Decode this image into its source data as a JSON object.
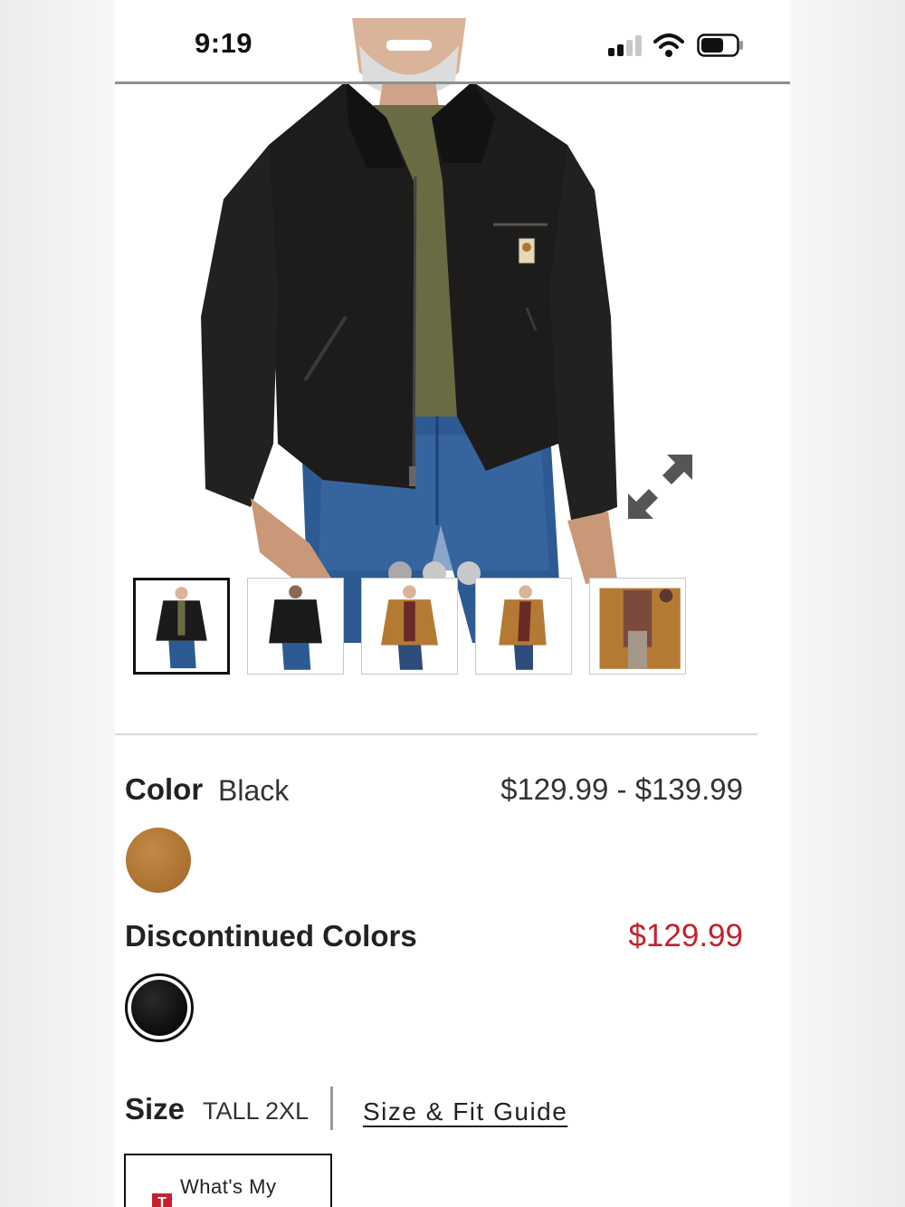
{
  "status_bar": {
    "time": "9:19"
  },
  "product": {
    "image_dots": 3,
    "thumbnails": [
      {
        "color": "black",
        "view": "front",
        "selected": true
      },
      {
        "color": "black",
        "view": "back",
        "selected": false
      },
      {
        "color": "brown",
        "view": "front",
        "selected": false
      },
      {
        "color": "brown",
        "view": "side",
        "selected": false
      },
      {
        "color": "brown",
        "view": "detail",
        "selected": false
      }
    ]
  },
  "color": {
    "label": "Color",
    "value": "Black",
    "price_range": "$129.99 - $139.99",
    "swatch_color": "#b07533"
  },
  "discontinued": {
    "label": "Discontinued Colors",
    "sale_price": "$129.99",
    "sale_color": "#c5202e",
    "swatch_color": "#111111"
  },
  "size": {
    "label": "Size",
    "value": "TALL 2XL",
    "fit_guide": "Size & Fit Guide"
  },
  "fit_helper": {
    "label": "What's My",
    "icon_letter": "T"
  }
}
